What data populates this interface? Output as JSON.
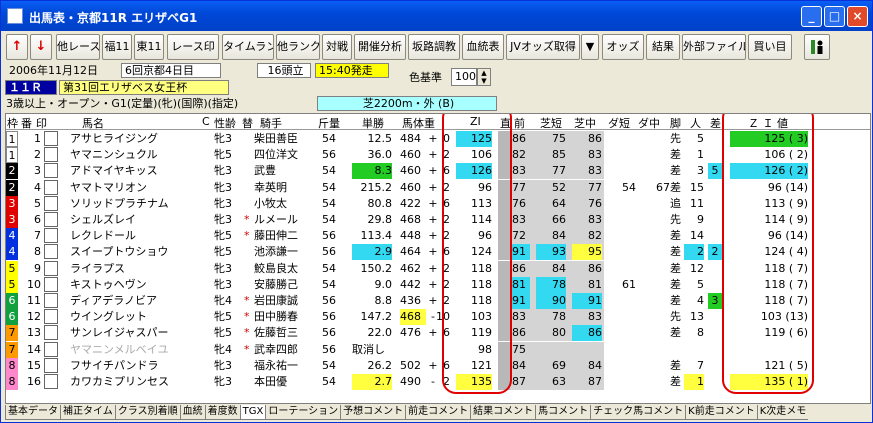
{
  "window": {
    "title": "出馬表・京都11R エリザベG1",
    "min_label": "_",
    "max_label": "□",
    "close_label": "×"
  },
  "toolbar": {
    "up": "↑",
    "down": "↓",
    "buttons": [
      "他レース",
      "福11",
      "東11",
      "レース印",
      "タイムランク",
      "他ランク",
      "対戦",
      "開催分析",
      "坂路調教",
      "血統表",
      "JVオッズ取得",
      "オッズ",
      "結果",
      "外部ファイル",
      "買い目"
    ],
    "dropdown": "▼"
  },
  "race": {
    "date": "2006年11月12日",
    "meeting": "6回京都4日目",
    "race_no": "１１Ｒ",
    "race_name": "第31回エリザベス女王杯",
    "conditions": "3歳以上・オープン・G1(定量)(牝)(国際)(指定)",
    "heads": "16頭立",
    "post_time": "15:40発走",
    "color_label": "色基準",
    "color_value": "100",
    "course": "芝2200m・外 (B)"
  },
  "headers": {
    "waku": "枠",
    "num": "番",
    "mark": "印",
    "name": "馬名",
    "c": "C",
    "sexage": "性齢",
    "change": "替",
    "jockey": "騎手",
    "weight": "斤量",
    "odds": "単勝",
    "body": "馬体重",
    "zi": "ZI",
    "straight": "直",
    "zen": "前",
    "shiba_short": "芝短",
    "shiba_mid": "芝中",
    "dirt_short": "ダ短",
    "dirt_mid": "ダ中",
    "style": "脚",
    "pop": "人",
    "diff": "差",
    "zival": "Ｚ Ｉ 値"
  },
  "rows": [
    {
      "waku": "1",
      "num": "1",
      "mark": "",
      "name": "アサヒライジング",
      "sexage": "牝3",
      "change": "",
      "jockey": "柴田善臣",
      "weight": "54",
      "odds": "12.5",
      "body": "484",
      "sign": "+",
      "delta": "0",
      "zi": "125",
      "zen": "86",
      "ss": "75",
      "sm": "86",
      "ds": "",
      "dm": "",
      "style": "先",
      "pop": "5",
      "diff": "",
      "zival": "125 ( 3)"
    },
    {
      "waku": "1",
      "num": "2",
      "mark": "",
      "name": "ヤマニンシュクル",
      "sexage": "牝5",
      "change": "",
      "jockey": "四位洋文",
      "weight": "56",
      "odds": "36.0",
      "body": "460",
      "sign": "+",
      "delta": "2",
      "zi": "106",
      "zen": "82",
      "ss": "85",
      "sm": "83",
      "ds": "",
      "dm": "",
      "style": "差",
      "pop": "1",
      "diff": "",
      "zival": "106 ( 2)"
    },
    {
      "waku": "2",
      "num": "3",
      "mark": "",
      "name": "アドマイヤキッス",
      "sexage": "牝3",
      "change": "",
      "jockey": "武豊",
      "weight": "54",
      "odds": "8.3",
      "body": "460",
      "sign": "+",
      "delta": "6",
      "zi": "126",
      "zen": "83",
      "ss": "77",
      "sm": "83",
      "ds": "",
      "dm": "",
      "style": "差",
      "pop": "3",
      "diff": "5",
      "zival": "126 ( 2)"
    },
    {
      "waku": "2",
      "num": "4",
      "mark": "",
      "name": "ヤマトマリオン",
      "sexage": "牝3",
      "change": "",
      "jockey": "幸英明",
      "weight": "54",
      "odds": "215.2",
      "body": "460",
      "sign": "+",
      "delta": "2",
      "zi": "96",
      "zen": "77",
      "ss": "52",
      "sm": "77",
      "ds": "54",
      "dm": "67",
      "style": "差",
      "pop": "15",
      "diff": "",
      "zival": "96 (14)"
    },
    {
      "waku": "3",
      "num": "5",
      "mark": "",
      "name": "ソリッドプラチナム",
      "sexage": "牝3",
      "change": "",
      "jockey": "小牧太",
      "weight": "54",
      "odds": "80.8",
      "body": "422",
      "sign": "+",
      "delta": "6",
      "zi": "113",
      "zen": "76",
      "ss": "64",
      "sm": "76",
      "ds": "",
      "dm": "",
      "style": "追",
      "pop": "11",
      "diff": "",
      "zival": "113 ( 9)"
    },
    {
      "waku": "3",
      "num": "6",
      "mark": "",
      "name": "シェルズレイ",
      "sexage": "牝3",
      "change": "*",
      "jockey": "ルメール",
      "weight": "54",
      "odds": "29.8",
      "body": "468",
      "sign": "+",
      "delta": "2",
      "zi": "114",
      "zen": "83",
      "ss": "66",
      "sm": "83",
      "ds": "",
      "dm": "",
      "style": "先",
      "pop": "9",
      "diff": "",
      "zival": "114 ( 9)"
    },
    {
      "waku": "4",
      "num": "7",
      "mark": "",
      "name": "レクレドール",
      "sexage": "牝5",
      "change": "*",
      "jockey": "藤田伸二",
      "weight": "56",
      "odds": "113.4",
      "body": "448",
      "sign": "+",
      "delta": "2",
      "zi": "96",
      "zen": "72",
      "ss": "84",
      "sm": "82",
      "ds": "",
      "dm": "",
      "style": "差",
      "pop": "14",
      "diff": "",
      "zival": "96 (14)"
    },
    {
      "waku": "4",
      "num": "8",
      "mark": "",
      "name": "スイープトウショウ",
      "sexage": "牝5",
      "change": "",
      "jockey": "池添謙一",
      "weight": "56",
      "odds": "2.9",
      "body": "464",
      "sign": "+",
      "delta": "6",
      "zi": "124",
      "zen": "91",
      "ss": "93",
      "sm": "95",
      "ds": "",
      "dm": "",
      "style": "差",
      "pop": "2",
      "diff": "2",
      "zival": "124 ( 4)"
    },
    {
      "waku": "5",
      "num": "9",
      "mark": "",
      "name": "ライラプス",
      "sexage": "牝3",
      "change": "",
      "jockey": "鮫島良太",
      "weight": "54",
      "odds": "150.2",
      "body": "462",
      "sign": "+",
      "delta": "2",
      "zi": "118",
      "zen": "86",
      "ss": "84",
      "sm": "86",
      "ds": "",
      "dm": "",
      "style": "差",
      "pop": "12",
      "diff": "",
      "zival": "118 ( 7)"
    },
    {
      "waku": "5",
      "num": "10",
      "mark": "",
      "name": "キストゥヘヴン",
      "sexage": "牝3",
      "change": "",
      "jockey": "安藤勝己",
      "weight": "54",
      "odds": "9.0",
      "body": "442",
      "sign": "+",
      "delta": "2",
      "zi": "118",
      "zen": "81",
      "ss": "78",
      "sm": "81",
      "ds": "61",
      "dm": "",
      "style": "差",
      "pop": "5",
      "diff": "",
      "zival": "118 ( 7)"
    },
    {
      "waku": "6",
      "num": "11",
      "mark": "",
      "name": "ディアデラノビア",
      "sexage": "牝4",
      "change": "*",
      "jockey": "岩田康誠",
      "weight": "56",
      "odds": "8.8",
      "body": "436",
      "sign": "+",
      "delta": "2",
      "zi": "118",
      "zen": "91",
      "ss": "90",
      "sm": "91",
      "ds": "",
      "dm": "",
      "style": "差",
      "pop": "4",
      "diff": "3",
      "zival": "118 ( 7)"
    },
    {
      "waku": "6",
      "num": "12",
      "mark": "",
      "name": "ウイングレット",
      "sexage": "牝5",
      "change": "*",
      "jockey": "田中勝春",
      "weight": "56",
      "odds": "147.2",
      "body": "468",
      "sign": "-",
      "delta": "10",
      "zi": "103",
      "zen": "83",
      "ss": "78",
      "sm": "83",
      "ds": "",
      "dm": "",
      "style": "先",
      "pop": "13",
      "diff": "",
      "zival": "103 (13)"
    },
    {
      "waku": "7",
      "num": "13",
      "mark": "",
      "name": "サンレイジャスパー",
      "sexage": "牝5",
      "change": "*",
      "jockey": "佐藤哲三",
      "weight": "56",
      "odds": "22.0",
      "body": "476",
      "sign": "+",
      "delta": "6",
      "zi": "119",
      "zen": "86",
      "ss": "80",
      "sm": "86",
      "ds": "",
      "dm": "",
      "style": "差",
      "pop": "8",
      "diff": "",
      "zival": "119 ( 6)"
    },
    {
      "waku": "7",
      "num": "14",
      "mark": "",
      "name": "ヤマニンメルベイユ",
      "sexage": "牝4",
      "change": "*",
      "jockey": "武幸四郎",
      "weight": "56",
      "odds": "取消し",
      "body": "",
      "sign": "",
      "delta": "",
      "zi": "98",
      "zen": "75",
      "ss": "",
      "sm": "",
      "ds": "",
      "dm": "",
      "style": "",
      "pop": "",
      "diff": "",
      "zival": ""
    },
    {
      "waku": "8",
      "num": "15",
      "mark": "",
      "name": "フサイチパンドラ",
      "sexage": "牝3",
      "change": "",
      "jockey": "福永祐一",
      "weight": "54",
      "odds": "26.2",
      "body": "502",
      "sign": "+",
      "delta": "6",
      "zi": "121",
      "zen": "84",
      "ss": "69",
      "sm": "84",
      "ds": "",
      "dm": "",
      "style": "差",
      "pop": "7",
      "diff": "",
      "zival": "121 ( 5)"
    },
    {
      "waku": "8",
      "num": "16",
      "mark": "",
      "name": "カワカミプリンセス",
      "sexage": "牝3",
      "change": "",
      "jockey": "本田優",
      "weight": "54",
      "odds": "2.7",
      "body": "490",
      "sign": "-",
      "delta": "2",
      "zi": "135",
      "zen": "87",
      "ss": "63",
      "sm": "87",
      "ds": "",
      "dm": "",
      "style": "差",
      "pop": "1",
      "diff": "",
      "zival": "135 ( 1)"
    }
  ],
  "tabs": [
    "基本データ",
    "補正タイム",
    "クラス別着順",
    "血統",
    "着度数",
    "TGX",
    "ローテーション",
    "予想コメント",
    "前走コメント",
    "結果コメント",
    "馬コメント",
    "チェック馬コメント",
    "K前走コメント",
    "K次走メモ"
  ],
  "colors": {
    "titlebar": "#0a5ff4",
    "highlight_cyan": "#33d9f0",
    "highlight_yellow": "#ffff40",
    "highlight_green": "#22cc22",
    "oval": "#e00000"
  }
}
